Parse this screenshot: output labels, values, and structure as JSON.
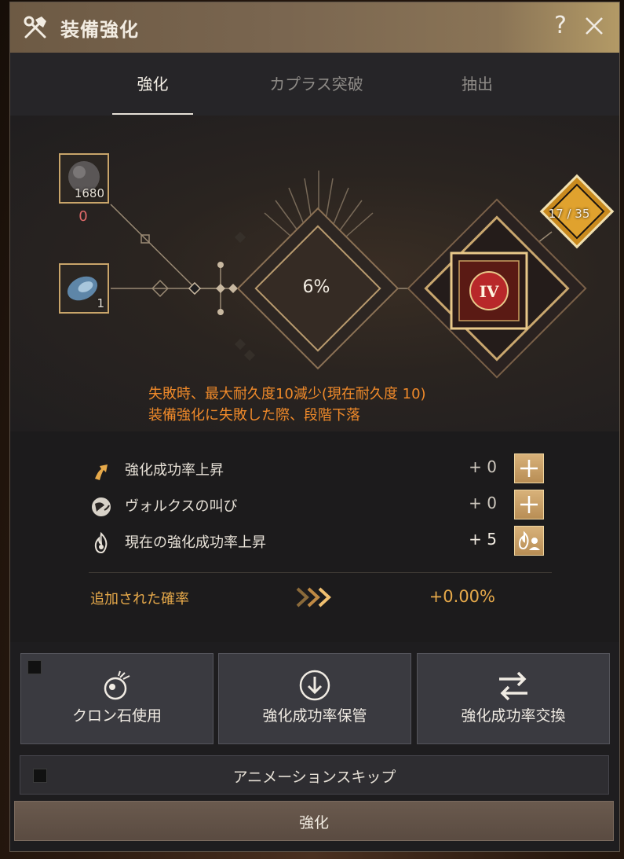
{
  "window": {
    "title": "装備強化",
    "help_label": "?",
    "title_icon": "hammer-wrench-icon",
    "close_icon": "close-icon"
  },
  "tabs": [
    {
      "label": "強化",
      "active": true
    },
    {
      "label": "カプラス突破",
      "active": false
    },
    {
      "label": "抽出",
      "active": false
    }
  ],
  "materials": {
    "black_stone_count": "1680",
    "black_stone_owned": "0",
    "crystal_count": "1"
  },
  "enhance": {
    "success_rate": "6%",
    "durability": "17 / 35",
    "target_grade": "IV",
    "warning_1": "失敗時、最大耐久度10減少(現在耐久度 10)",
    "warning_2": "装備強化に失敗した際、段階下落"
  },
  "bonuses": [
    {
      "label": "強化成功率上昇",
      "value": "+ 0",
      "icon": "arrow-up-icon"
    },
    {
      "label": "ヴォルクスの叫び",
      "value": "+ 0",
      "icon": "globe-icon"
    },
    {
      "label": "現在の強化成功率上昇",
      "value": "+ 5",
      "icon": "flame-icon"
    }
  ],
  "added": {
    "label": "追加された確率",
    "value": "+0.00%"
  },
  "actions": [
    {
      "label": "クロン石使用",
      "icon": "cron-stone-icon"
    },
    {
      "label": "強化成功率保管",
      "icon": "download-circle-icon"
    },
    {
      "label": "強化成功率交換",
      "icon": "swap-arrows-icon"
    }
  ],
  "skip_label": "アニメーションスキップ",
  "enhance_button_label": "強化",
  "colors": {
    "accent_gold": "#e6a94a",
    "warning_orange": "#f08a2a",
    "count_red": "#e06a6a"
  }
}
